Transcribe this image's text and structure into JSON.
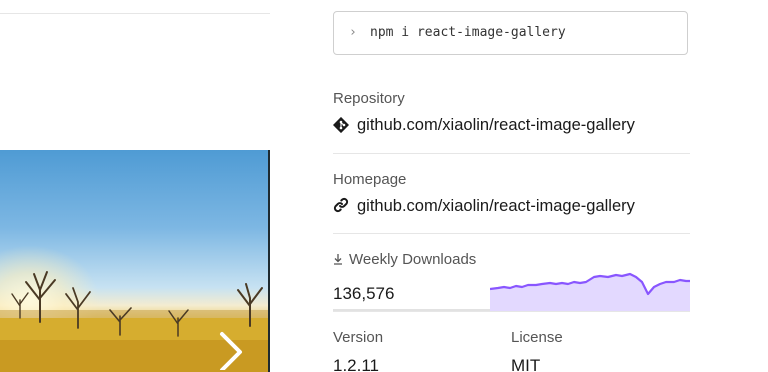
{
  "install": {
    "prompt_icon": "chevron-right-icon",
    "command": "npm i react-image-gallery"
  },
  "repository": {
    "label": "Repository",
    "icon": "git-icon",
    "value": "github.com/xiaolin/react-image-gallery"
  },
  "homepage": {
    "label": "Homepage",
    "icon": "link-icon",
    "value": "github.com/xiaolin/react-image-gallery"
  },
  "downloads": {
    "label": "Weekly Downloads",
    "icon": "download-icon",
    "count": "136,576",
    "accent": "#8956ff",
    "fill": "#e3d9ff"
  },
  "version": {
    "label": "Version",
    "value": "1.2.11"
  },
  "license": {
    "label": "License",
    "value": "MIT"
  },
  "gallery": {
    "next_icon": "chevron-right-icon"
  }
}
